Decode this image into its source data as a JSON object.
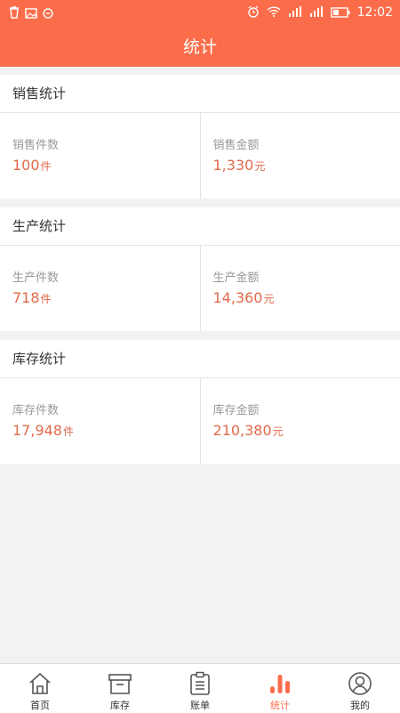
{
  "status_bar": {
    "time": "12:02"
  },
  "header": {
    "title": "统计"
  },
  "sections": [
    {
      "title": "销售统计",
      "items": [
        {
          "label": "销售件数",
          "value": "100",
          "unit": "件"
        },
        {
          "label": "销售金额",
          "value": "1,330",
          "unit": "元"
        }
      ]
    },
    {
      "title": "生产统计",
      "items": [
        {
          "label": "生产件数",
          "value": "718",
          "unit": "件"
        },
        {
          "label": "生产金额",
          "value": "14,360",
          "unit": "元"
        }
      ]
    },
    {
      "title": "库存统计",
      "items": [
        {
          "label": "库存件数",
          "value": "17,948",
          "unit": "件"
        },
        {
          "label": "库存金额",
          "value": "210,380",
          "unit": "元"
        }
      ]
    }
  ],
  "tabbar": {
    "active_tab": "统计",
    "tabs": [
      {
        "label": "首页",
        "icon": "home-icon"
      },
      {
        "label": "库存",
        "icon": "box-icon"
      },
      {
        "label": "账单",
        "icon": "clipboard-icon"
      },
      {
        "label": "统计",
        "icon": "bar-chart-icon"
      },
      {
        "label": "我的",
        "icon": "user-icon"
      }
    ]
  },
  "colors": {
    "accent": "#fb6d4a",
    "value_text": "#e06a4a"
  }
}
